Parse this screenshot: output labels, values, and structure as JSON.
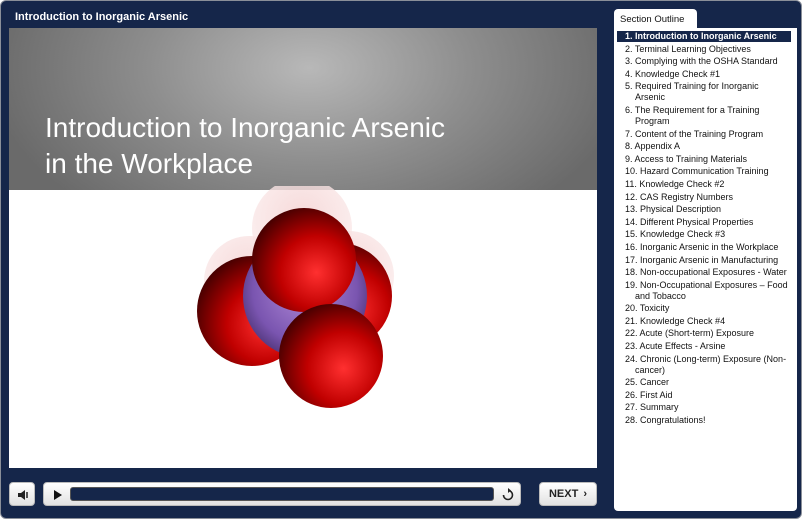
{
  "header": {
    "title": "Introduction to Inorganic Arsenic"
  },
  "slide": {
    "title_line1": "Introduction to Inorganic Arsenic",
    "title_line2": "in the Workplace"
  },
  "controls": {
    "next_label": "NEXT",
    "progress": 0
  },
  "outline": {
    "tab_label": "Section Outline",
    "active_index": 0,
    "items": [
      "1. Introduction to Inorganic Arsenic",
      "2. Terminal Learning Objectives",
      "3. Complying with the OSHA Standard",
      "4. Knowledge Check #1",
      "5. Required Training for Inorganic Arsenic",
      "6. The Requirement for a Training Program",
      "7. Content of the Training Program",
      "8. Appendix A",
      "9. Access to Training Materials",
      "10. Hazard Communication Training",
      "11. Knowledge Check #2",
      "12. CAS Registry Numbers",
      "13. Physical Description",
      "14. Different Physical Properties",
      "15. Knowledge Check #3",
      "16. Inorganic Arsenic in the Workplace",
      "17. Inorganic Arsenic in Manufacturing",
      "18. Non-occupational Exposures - Water",
      "19. Non-Occupational Exposures – Food and Tobacco",
      "20. Toxicity",
      "21. Knowledge Check #4",
      "22. Acute (Short-term) Exposure",
      "23. Acute Effects - Arsine",
      "24. Chronic (Long-term) Exposure (Non-cancer)",
      "25. Cancer",
      "26. First Aid",
      "27. Summary",
      "28. Congratulations!"
    ]
  }
}
